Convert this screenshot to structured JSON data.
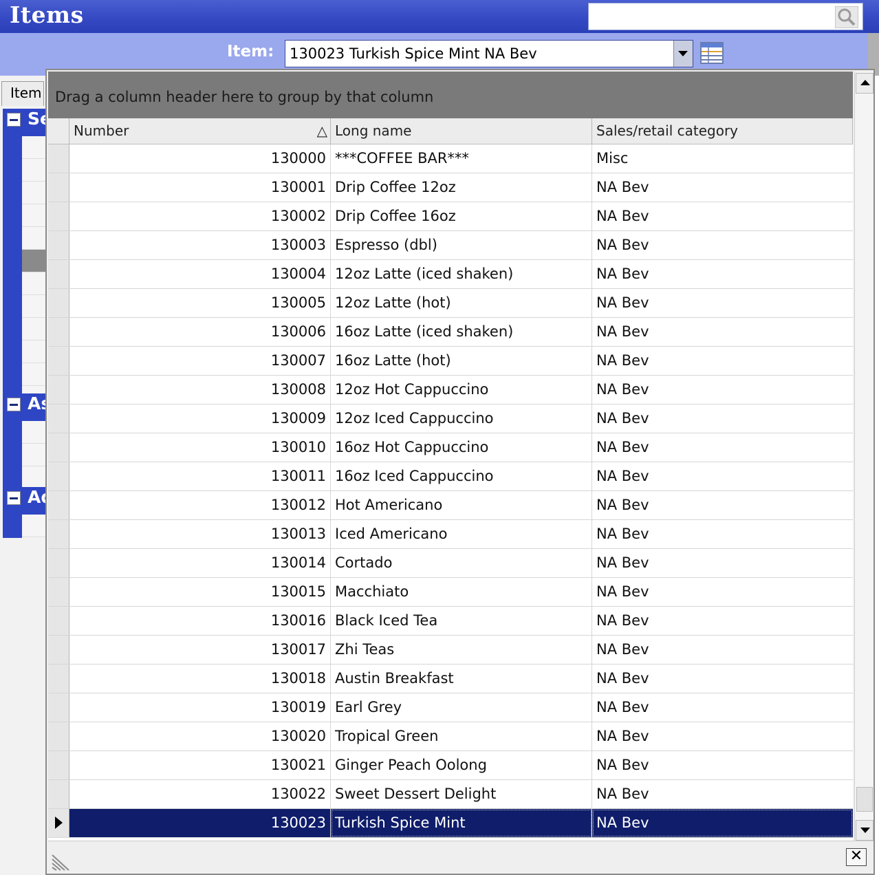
{
  "header": {
    "title": "Items",
    "search": {
      "value": "",
      "placeholder": "",
      "icon": "search-icon"
    }
  },
  "item_selector": {
    "label": "Item:",
    "value": "130023 Turkish Spice Mint NA Bev"
  },
  "background_form": {
    "tab_label": "Item",
    "sections": [
      {
        "title": "Se",
        "collapse_symbol": "−"
      },
      {
        "title": "As",
        "collapse_symbol": "−"
      },
      {
        "title": "Ad",
        "collapse_symbol": "−"
      }
    ]
  },
  "popup": {
    "group_hint": "Drag a column header here to group by that column",
    "columns": [
      {
        "label": "Number",
        "sorted": "ascending",
        "sort_symbol": "△"
      },
      {
        "label": "Long name"
      },
      {
        "label": "Sales/retail category"
      }
    ],
    "rows": [
      {
        "number": "130000",
        "name": "***COFFEE BAR***",
        "category": "Misc"
      },
      {
        "number": "130001",
        "name": "Drip Coffee 12oz",
        "category": "NA Bev"
      },
      {
        "number": "130002",
        "name": "Drip Coffee 16oz",
        "category": "NA Bev"
      },
      {
        "number": "130003",
        "name": "Espresso (dbl)",
        "category": "NA Bev"
      },
      {
        "number": "130004",
        "name": "12oz Latte (iced shaken)",
        "category": "NA Bev"
      },
      {
        "number": "130005",
        "name": "12oz Latte (hot)",
        "category": "NA Bev"
      },
      {
        "number": "130006",
        "name": "16oz Latte (iced shaken)",
        "category": "NA Bev"
      },
      {
        "number": "130007",
        "name": "16oz Latte (hot)",
        "category": "NA Bev"
      },
      {
        "number": "130008",
        "name": "12oz Hot Cappuccino",
        "category": "NA Bev"
      },
      {
        "number": "130009",
        "name": "12oz Iced Cappuccino",
        "category": "NA Bev"
      },
      {
        "number": "130010",
        "name": "16oz Hot Cappuccino",
        "category": "NA Bev"
      },
      {
        "number": "130011",
        "name": "16oz Iced Cappuccino",
        "category": "NA Bev"
      },
      {
        "number": "130012",
        "name": "Hot Americano",
        "category": "NA Bev"
      },
      {
        "number": "130013",
        "name": "Iced Americano",
        "category": "NA Bev"
      },
      {
        "number": "130014",
        "name": "Cortado",
        "category": "NA Bev"
      },
      {
        "number": "130015",
        "name": "Macchiato",
        "category": "NA Bev"
      },
      {
        "number": "130016",
        "name": "Black Iced Tea",
        "category": "NA Bev"
      },
      {
        "number": "130017",
        "name": "Zhi Teas",
        "category": "NA Bev"
      },
      {
        "number": "130018",
        "name": "Austin Breakfast",
        "category": "NA Bev"
      },
      {
        "number": "130019",
        "name": "Earl Grey",
        "category": "NA Bev"
      },
      {
        "number": "130020",
        "name": "Tropical Green",
        "category": "NA Bev"
      },
      {
        "number": "130021",
        "name": "Ginger Peach Oolong",
        "category": "NA Bev"
      },
      {
        "number": "130022",
        "name": "Sweet Dessert Delight",
        "category": "NA Bev"
      },
      {
        "number": "130023",
        "name": "Turkish Spice Mint",
        "category": "NA Bev",
        "selected": true
      }
    ],
    "close_symbol": "✕"
  },
  "colors": {
    "header_blue": "#3549c4",
    "item_bar": "#9aa8ee",
    "selected_row": "#0f1d6b",
    "group_panel": "#7a7a7a"
  }
}
